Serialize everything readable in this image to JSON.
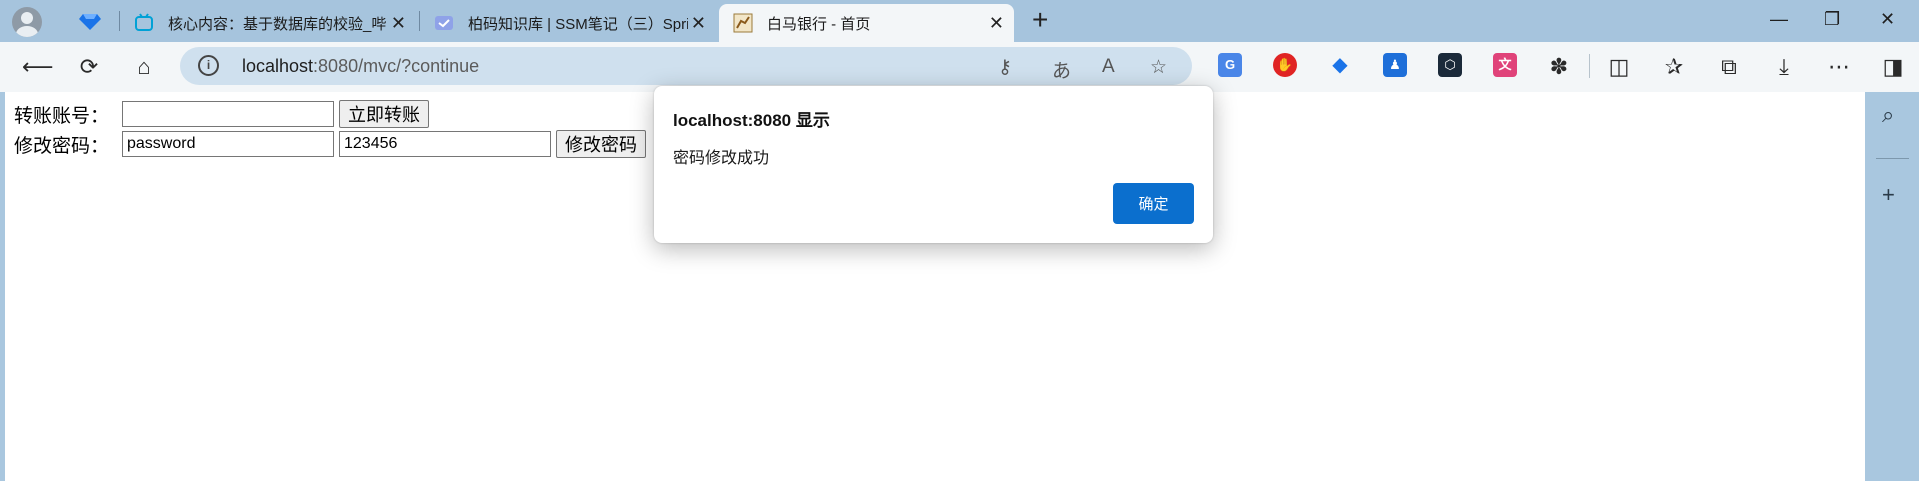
{
  "tabs": [
    {
      "title": "核心内容：基于数据库的校验_哔",
      "favicon_color": "#00a1d6"
    },
    {
      "title": "柏码知识库 | SSM笔记（三）Spri",
      "favicon_color": "#6d7fd6"
    },
    {
      "title": "白马银行 - 首页",
      "favicon_color": "#b8860b",
      "active": true
    }
  ],
  "address": {
    "host": "localhost",
    "rest": ":8080/mvc/?continue"
  },
  "form": {
    "transfer_label": "转账账号：",
    "transfer_value": "",
    "transfer_button": "立即转账",
    "password_label": "修改密码：",
    "old_password_value": "password",
    "new_password_value": "123456",
    "password_button": "修改密码"
  },
  "dialog": {
    "title": "localhost:8080 显示",
    "message": "密码修改成功",
    "ok_label": "确定"
  },
  "colors": {
    "accent": "#0b6fce",
    "chrome": "#a6c4dd",
    "toolbar": "#f3f6f8"
  }
}
